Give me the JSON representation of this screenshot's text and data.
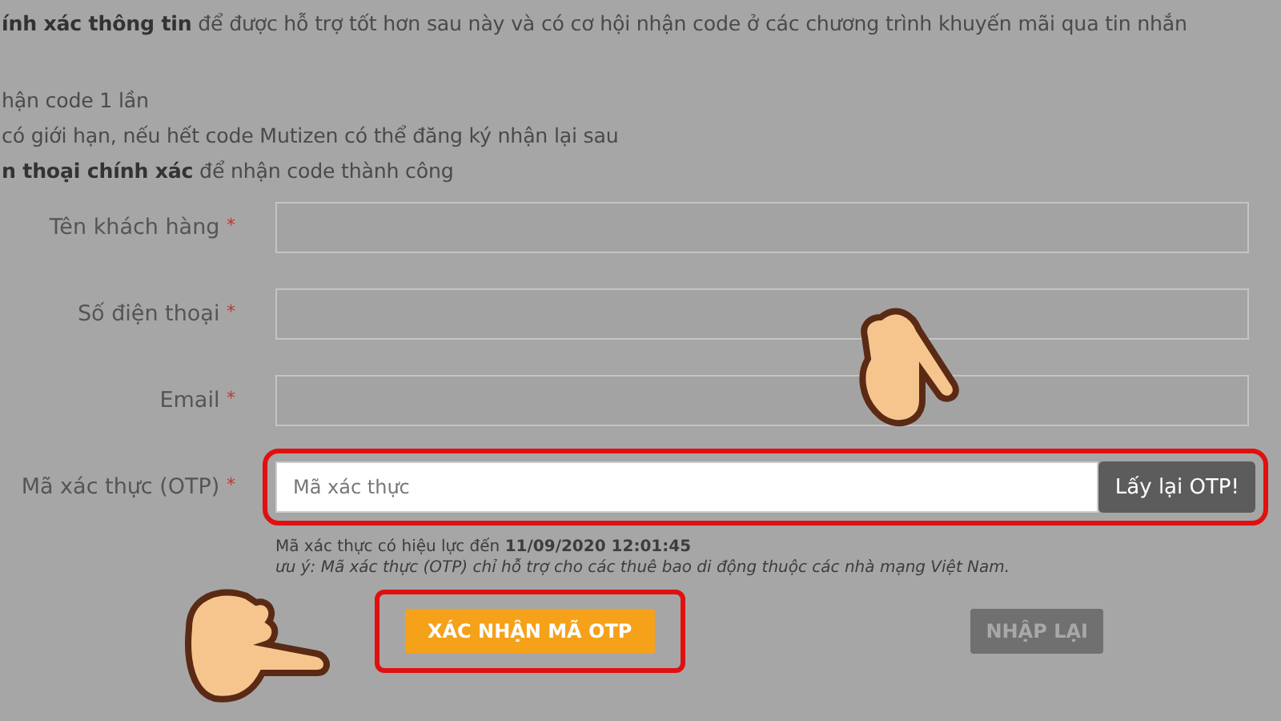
{
  "intro": {
    "text": "**ính xác thông tin** để được hỗ trợ tốt hơn sau này và có cơ hội nhận code ở các chương trình khuyến mãi qua tin nhắn",
    "notes": [
      "hận code 1 lần",
      "có giới hạn, nếu hết code Mutizen có thể đăng ký nhận lại sau",
      "**n thoại chính xác** để nhận code thành công"
    ]
  },
  "fields": [
    {
      "kind": "text",
      "label": "Tên khách hàng",
      "mark": "*",
      "highlighted": false
    },
    {
      "kind": "text",
      "label": "Số điện thoại",
      "mark": "*",
      "highlighted": false
    },
    {
      "kind": "text",
      "label": "Email",
      "mark": "*",
      "highlighted": false
    },
    {
      "kind": "otp",
      "label": "Mã xác thực (OTP)",
      "mark": "*",
      "highlighted": true,
      "placeholder": "Mã xác thực",
      "button": "Lấy lại OTP!"
    }
  ],
  "validity": "Mã xác thực có hiệu lực đến **11/09/2020 12:01:45**",
  "warning": "ưu ý: Mã xác thực (OTP) chỉ hỗ trợ cho các thuê bao di động thuộc các nhà mạng Việt Nam.",
  "actions": [
    {
      "kind": "primary",
      "label": "XÁC NHẬN MÃ OTP",
      "highlighted": true
    },
    {
      "kind": "secondary",
      "label": "NHẬP LẠI",
      "highlighted": false
    }
  ]
}
